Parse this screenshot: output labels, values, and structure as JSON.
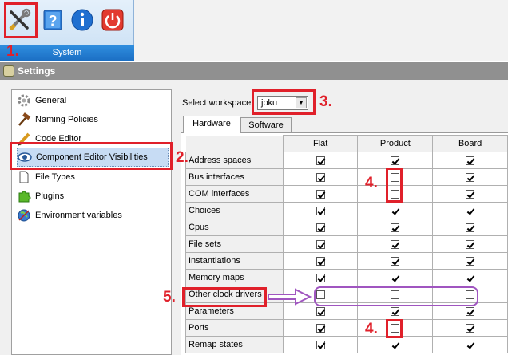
{
  "ribbon": {
    "group_label": "System",
    "buttons": [
      {
        "name": "settings-tools-icon"
      },
      {
        "name": "help-book-icon"
      },
      {
        "name": "info-icon"
      },
      {
        "name": "power-icon"
      }
    ]
  },
  "window": {
    "title": "Settings"
  },
  "nav": {
    "items": [
      {
        "label": "General",
        "icon": "gear-icon"
      },
      {
        "label": "Naming Policies",
        "icon": "gavel-icon"
      },
      {
        "label": "Code Editor",
        "icon": "pencil-icon"
      },
      {
        "label": "Component Editor Visibilities",
        "icon": "eye-icon",
        "selected": true
      },
      {
        "label": "File Types",
        "icon": "file-icon"
      },
      {
        "label": "Plugins",
        "icon": "puzzle-icon"
      },
      {
        "label": "Environment variables",
        "icon": "globe-icon"
      }
    ]
  },
  "workspace": {
    "label": "Select workspace",
    "value": "joku"
  },
  "tabs": [
    {
      "label": "Hardware",
      "active": true
    },
    {
      "label": "Software",
      "active": false
    }
  ],
  "table": {
    "columns": [
      "Flat",
      "Product",
      "Board"
    ],
    "rows": [
      {
        "label": "Address spaces",
        "values": [
          true,
          true,
          true
        ]
      },
      {
        "label": "Bus interfaces",
        "values": [
          true,
          false,
          true
        ]
      },
      {
        "label": "COM interfaces",
        "values": [
          true,
          false,
          true
        ]
      },
      {
        "label": "Choices",
        "values": [
          true,
          true,
          true
        ]
      },
      {
        "label": "Cpus",
        "values": [
          true,
          true,
          true
        ]
      },
      {
        "label": "File sets",
        "values": [
          true,
          true,
          true
        ]
      },
      {
        "label": "Instantiations",
        "values": [
          true,
          true,
          true
        ]
      },
      {
        "label": "Memory maps",
        "values": [
          true,
          true,
          true
        ]
      },
      {
        "label": "Other clock drivers",
        "values": [
          false,
          false,
          false
        ]
      },
      {
        "label": "Parameters",
        "values": [
          true,
          true,
          true
        ]
      },
      {
        "label": "Ports",
        "values": [
          true,
          false,
          true
        ]
      },
      {
        "label": "Remap states",
        "values": [
          true,
          true,
          true
        ]
      }
    ]
  },
  "annotations": {
    "n1": "1.",
    "n2": "2.",
    "n3": "3.",
    "n4a": "4.",
    "n4b": "4.",
    "n5": "5."
  },
  "colors": {
    "annotation_red": "#e0202a",
    "annotation_purple": "#a055c0",
    "selection": "#c7dcf4"
  }
}
